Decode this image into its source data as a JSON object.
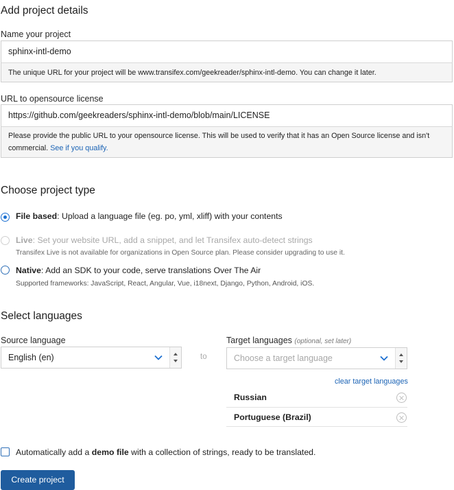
{
  "details": {
    "heading": "Add project details",
    "name_label": "Name your project",
    "name_value": "sphinx-intl-demo",
    "name_help": "The unique URL for your project will be www.transifex.com/geekreader/sphinx-intl-demo. You can change it later.",
    "license_label": "URL to opensource license",
    "license_value": "https://github.com/geekreaders/sphinx-intl-demo/blob/main/LICENSE",
    "license_help": "Please provide the public URL to your opensource license. This will be used to verify that it has an Open Source license and isn't commercial.",
    "license_help_link": "See if you qualify."
  },
  "project_type": {
    "heading": "Choose project type",
    "options": [
      {
        "title": "File based",
        "desc": ": Upload a language file (eg. po, yml, xliff) with your contents",
        "sub": "",
        "state": "checked"
      },
      {
        "title": "Live",
        "desc": ": Set your website URL, add a snippet, and let Transifex auto-detect strings",
        "sub": "Transifex Live is not available for organizations in Open Source plan. Please consider upgrading to use it.",
        "state": "disabled"
      },
      {
        "title": "Native",
        "desc": ": Add an SDK to your code, serve translations Over The Air",
        "sub": "Supported frameworks: JavaScript, React, Angular, Vue, i18next, Django, Python, Android, iOS.",
        "state": "unchecked"
      }
    ]
  },
  "languages": {
    "heading": "Select languages",
    "source_label": "Source language",
    "source_value": "English (en)",
    "to_label": "to",
    "target_label": "Target languages",
    "target_hint": "(optional, set later)",
    "target_placeholder": "Choose a target language",
    "clear_link": "clear target languages",
    "selected": [
      "Russian",
      "Portuguese (Brazil)"
    ]
  },
  "demo": {
    "text_before": "Automatically add a ",
    "text_bold": "demo file",
    "text_after": " with a collection of strings, ready to be translated."
  },
  "create_button": "Create project",
  "colors": {
    "accent": "#1b6fd1",
    "button": "#1f5c9e",
    "link": "#1b63b5"
  }
}
